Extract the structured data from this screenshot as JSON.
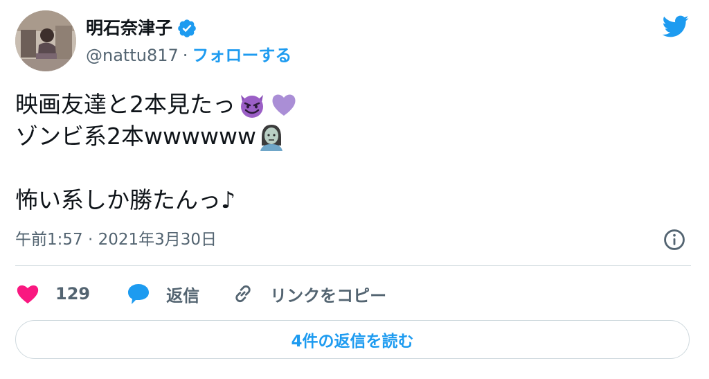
{
  "author": {
    "display_name": "明石奈津子",
    "handle": "@nattu817",
    "separator": "·",
    "follow_label": "フォローする",
    "verified": true
  },
  "tweet": {
    "lines": [
      {
        "text": "映画友達と2本見たっ",
        "emojis": [
          "smiling-imp-emoji",
          "purple-heart-emoji"
        ]
      },
      {
        "text": "ゾンビ系2本wwwwww",
        "emojis": [
          "female-zombie-emoji"
        ]
      },
      {
        "text": "",
        "emojis": []
      },
      {
        "text": "怖い系しか勝たんっ♪",
        "emojis": []
      }
    ],
    "timestamp": "午前1:57 · 2021年3月30日"
  },
  "actions": {
    "like_count": "129",
    "reply_label": "返信",
    "copy_link_label": "リンクをコピー"
  },
  "read_replies_label": "4件の返信を読む",
  "colors": {
    "accent": "#1d9bf0",
    "like": "#f91880",
    "text": "#0f1419",
    "secondary": "#536471",
    "border": "#cfd9de",
    "emoji_purple": "#9b5fc6"
  }
}
